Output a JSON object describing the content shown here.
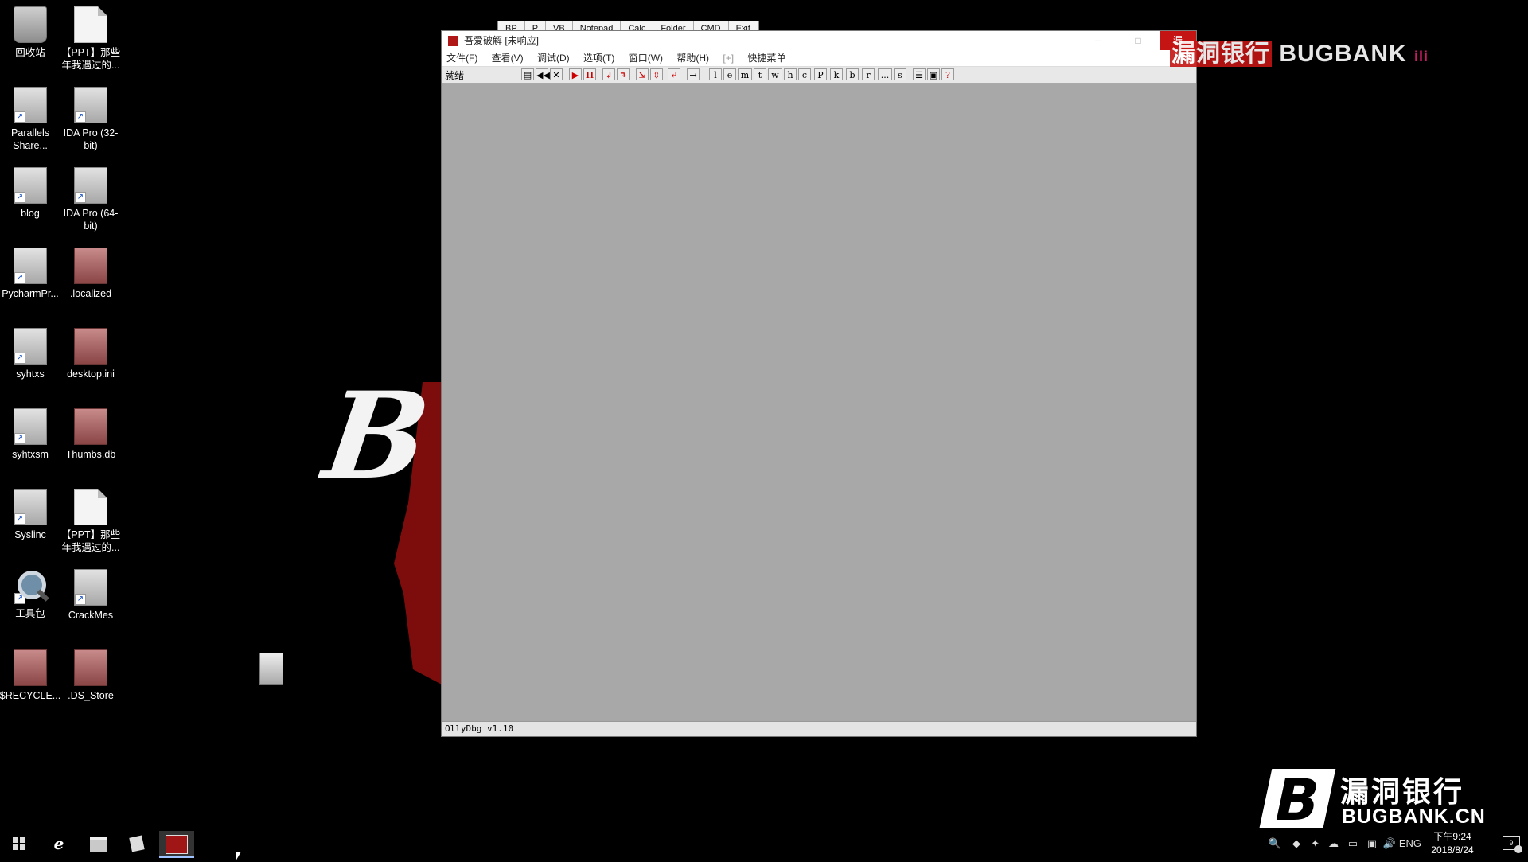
{
  "desktop": {
    "icons": [
      {
        "label": "回收站",
        "type": "bin"
      },
      {
        "label": "【PPT】那些年我遇过的...",
        "type": "file"
      },
      {
        "label": "Parallels Share...",
        "type": "gray"
      },
      {
        "label": "IDA Pro (32-bit)",
        "type": "gray"
      },
      {
        "label": "blog",
        "type": "gray"
      },
      {
        "label": "IDA Pro (64-bit)",
        "type": "gray"
      },
      {
        "label": "PycharmPr...",
        "type": "gray"
      },
      {
        "label": ".localized",
        "type": "pink"
      },
      {
        "label": "syhtxs",
        "type": "gray"
      },
      {
        "label": "desktop.ini",
        "type": "pink"
      },
      {
        "label": "syhtxsm",
        "type": "gray"
      },
      {
        "label": "Thumbs.db",
        "type": "pink"
      },
      {
        "label": "Syslinc",
        "type": "gray"
      },
      {
        "label": "【PPT】那些年我遇过的...",
        "type": "file"
      },
      {
        "label": "工具包",
        "type": "mag"
      },
      {
        "label": "CrackMes",
        "type": "gray"
      },
      {
        "label": "$RECYCLE...",
        "type": "pink"
      },
      {
        "label": ".DS_Store",
        "type": "pink"
      }
    ]
  },
  "quickbar": {
    "items": [
      "BP",
      "P",
      "VB",
      "Notepad",
      "Calc",
      "Folder",
      "CMD",
      "Exit"
    ]
  },
  "window": {
    "title": "吾爱破解 [未响应]",
    "min": "─",
    "max": "□",
    "close": "漏",
    "menus": [
      "文件(F)",
      "查看(V)",
      "调试(D)",
      "选项(T)",
      "窗口(W)",
      "帮助(H)",
      "[+]",
      "快捷菜单"
    ],
    "toolbar_status": "就绪",
    "toolbar_letters": [
      "l",
      "e",
      "m",
      "t",
      "w",
      "h",
      "c",
      "P",
      "k",
      "b",
      "r",
      "...",
      "s"
    ],
    "statusbar": "OllyDbg v1.10"
  },
  "watermark": {
    "top_cn": "漏洞银行",
    "top_en": "BUGBANK",
    "top_tag": "ili",
    "brand_cn": "漏洞银行",
    "brand_en": "BUGBANK.CN",
    "brand_letter": "B"
  },
  "background_letter": "B",
  "taskbar": {
    "tray_lang": "ENG",
    "time": "下午9:24",
    "date": "2018/8/24",
    "notif_count": "9"
  }
}
